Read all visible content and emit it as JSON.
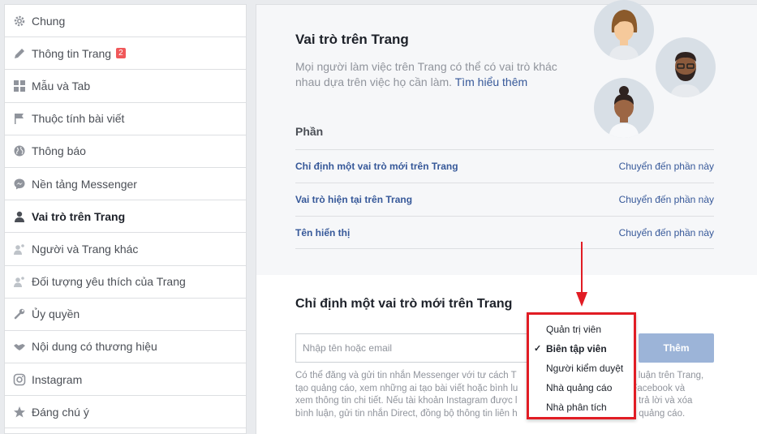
{
  "sidebar": {
    "items": [
      {
        "label": "Chung",
        "icon": "gear-icon"
      },
      {
        "label": "Thông tin Trang",
        "icon": "pencil-icon",
        "badge": "2"
      },
      {
        "label": "Mẫu và Tab",
        "icon": "grid-icon"
      },
      {
        "label": "Thuộc tính bài viết",
        "icon": "flag-icon"
      },
      {
        "label": "Thông báo",
        "icon": "globe-icon"
      },
      {
        "label": "Nền tảng Messenger",
        "icon": "messenger-icon"
      },
      {
        "label": "Vai trò trên Trang",
        "icon": "person-icon",
        "active": true
      },
      {
        "label": "Người và Trang khác",
        "icon": "people-icon"
      },
      {
        "label": "Đối tượng yêu thích của Trang",
        "icon": "people-star-icon"
      },
      {
        "label": "Ủy quyền",
        "icon": "wrench-icon"
      },
      {
        "label": "Nội dung có thương hiệu",
        "icon": "handshake-icon"
      },
      {
        "label": "Instagram",
        "icon": "instagram-icon"
      },
      {
        "label": "Đáng chú ý",
        "icon": "star-icon"
      }
    ]
  },
  "roles": {
    "title": "Vai trò trên Trang",
    "description": "Mọi người làm việc trên Trang có thể có vai trò khác nhau dựa trên việc họ cần làm.",
    "learn_more": "Tìm hiểu thêm",
    "section_label": "Phần",
    "sections": [
      {
        "name": "Chỉ định một vai trò mới trên Trang",
        "action": "Chuyển đến phần này"
      },
      {
        "name": "Vai trò hiện tại trên Trang",
        "action": "Chuyển đến phần này"
      },
      {
        "name": "Tên hiển thị",
        "action": "Chuyển đến phần này"
      }
    ]
  },
  "assign": {
    "title": "Chỉ định một vai trò mới trên Trang",
    "input_placeholder": "Nhập tên hoặc email",
    "input_value": "",
    "add_label": "Thêm",
    "note": "Có thể đăng và gửi tin nhắn Messenger với tư cách T... ...luận trên Trang, tạo quảng cáo, xem những ai tạo bài viết hoặc bình lu... ...Facebook và xem thông tin chi tiết. Nếu tài khoản Instagram được l... ...ể trả lời và xóa bình luận, gửi tin nhắn Direct, đồng bộ thông tin liên h... ...o quảng cáo.",
    "note_lines": [
      "Có thể đăng và gửi tin nhắn Messenger với tư cách T",
      "luận trên Trang,",
      "tạo quảng cáo, xem những ai tạo bài viết hoặc bình lu",
      "Facebook và",
      "xem thông tin chi tiết. Nếu tài khoản Instagram được l",
      "ể trả lời và xóa",
      "bình luận, gửi tin nhắn Direct, đồng bộ thông tin liên h",
      "o quảng cáo."
    ]
  },
  "role_dropdown": {
    "options": [
      {
        "label": "Quản trị viên",
        "selected": false
      },
      {
        "label": "Biên tập viên",
        "selected": true
      },
      {
        "label": "Người kiểm duyệt",
        "selected": false
      },
      {
        "label": "Nhà quảng cáo",
        "selected": false
      },
      {
        "label": "Nhà phân tích",
        "selected": false
      }
    ],
    "check_glyph": "✓"
  },
  "colors": {
    "link": "#365899",
    "highlight": "#e11c24",
    "badge": "#f0585a",
    "button": "#9cb4d8"
  }
}
